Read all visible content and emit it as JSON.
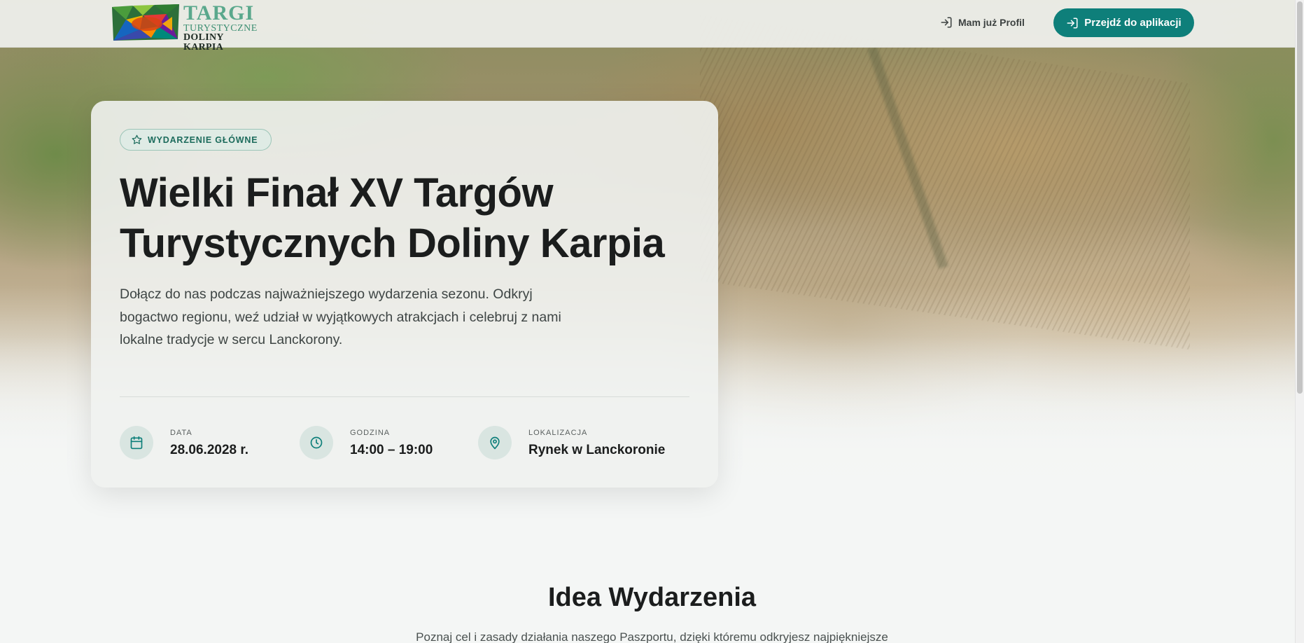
{
  "header": {
    "logo": {
      "line1": "TARGI",
      "line2": "TURYSTYCZNE",
      "line3": "DOLINY KARPIA"
    },
    "login_label": "Mam już Profil",
    "cta_label": "Przejdź do aplikacji",
    "accent_color": "#0e7f7a"
  },
  "hero": {
    "badge": "WYDARZENIE GŁÓWNE",
    "title": "Wielki Finał XV Targów Turystycznych Doliny Karpia",
    "description": "Dołącz do nas podczas najważniejszego wydarzenia sezonu. Odkryj bogactwo regionu, weź udział w wyjątkowych atrakcjach i celebruj z nami lokalne tradycje w sercu Lanckorony.",
    "info": [
      {
        "icon": "calendar-icon",
        "label": "DATA",
        "value": "28.06.2028 r."
      },
      {
        "icon": "clock-icon",
        "label": "GODZINA",
        "value": "14:00 – 19:00"
      },
      {
        "icon": "map-pin-icon",
        "label": "LOKALIZACJA",
        "value": "Rynek w Lanckoronie"
      }
    ]
  },
  "section": {
    "title": "Idea Wydarzenia",
    "subtitle": "Poznaj cel i zasady działania naszego Paszportu, dzięki któremu odkryjesz najpiękniejsze"
  }
}
